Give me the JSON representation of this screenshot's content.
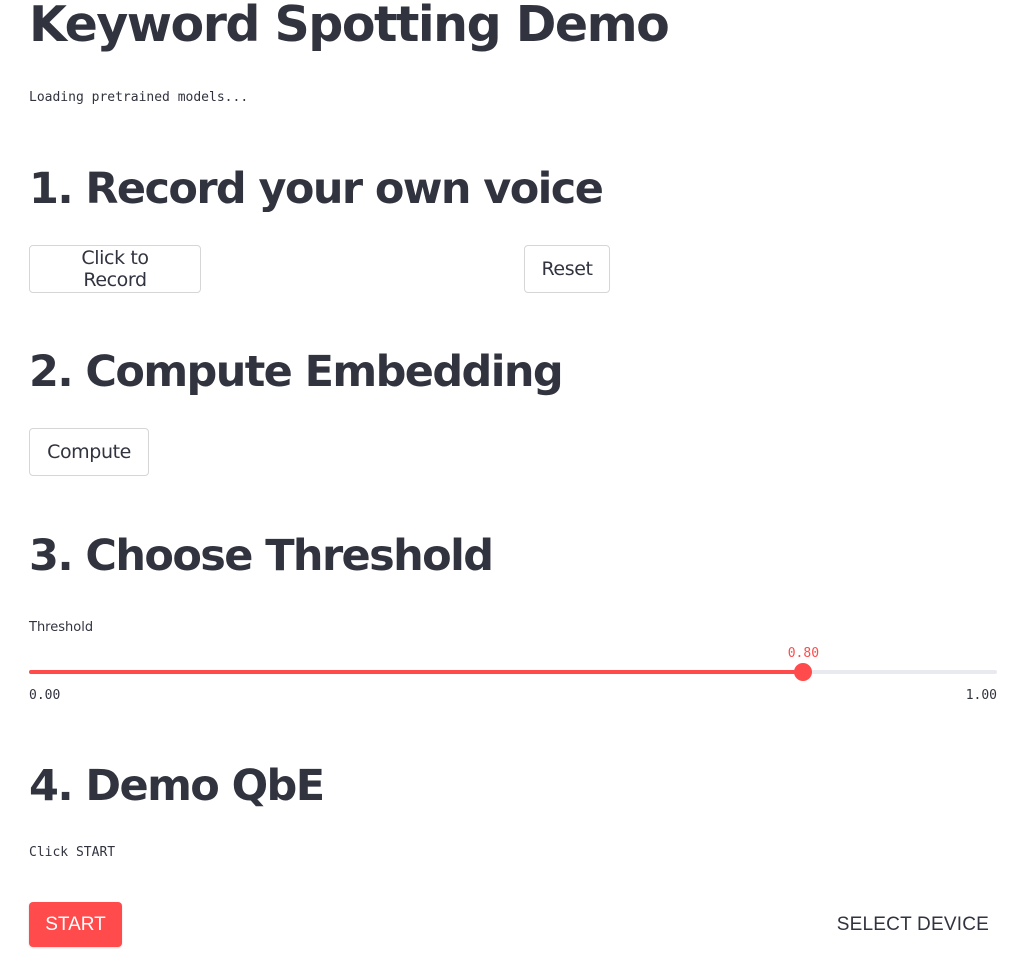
{
  "title": "Keyword Spotting Demo",
  "status_text": "Loading pretrained models...",
  "section1": {
    "heading": "1. Record your own voice",
    "record_label": "Click to Record",
    "reset_label": "Reset"
  },
  "section2": {
    "heading": "2. Compute Embedding",
    "compute_label": "Compute"
  },
  "section3": {
    "heading": "3. Choose Threshold",
    "slider": {
      "label": "Threshold",
      "value": 0.8,
      "value_text": "0.80",
      "min": 0,
      "max": 1,
      "min_text": "0.00",
      "max_text": "1.00"
    }
  },
  "section4": {
    "heading": "4. Demo QbE",
    "instruction": "Click START",
    "start_label": "START",
    "select_device_label": "SELECT DEVICE"
  },
  "colors": {
    "accent": "#ff4b4b",
    "text": "#31333f",
    "track": "#e9eaf0",
    "button_border": "#d6d6d9"
  }
}
